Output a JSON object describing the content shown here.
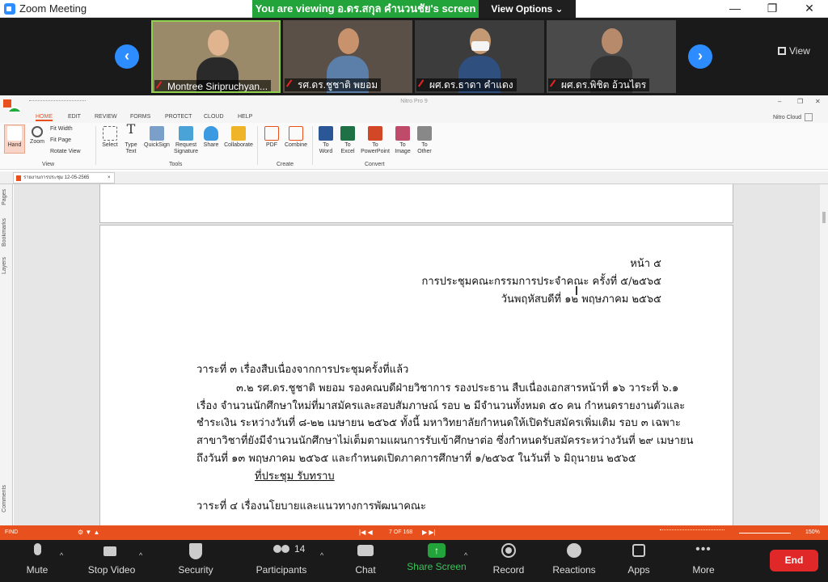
{
  "window": {
    "title": "Zoom Meeting",
    "viewing_banner": "You are viewing อ.ดร.สกุล คำนวนชัย's screen",
    "view_options": "View Options ⌄",
    "minimize": "—",
    "maximize": "❐",
    "close": "✕"
  },
  "gallery": {
    "view_label": "View",
    "prev": "‹",
    "next": "›",
    "participants": [
      {
        "name": "Montree Siripruchyan...",
        "bg": "#9a8a6a",
        "skin": "#e0b48e",
        "shirt": "#2a2a2a"
      },
      {
        "name": "รศ.ดร.ชูชาติ พยอม",
        "bg": "#5a5048",
        "skin": "#c8936c",
        "shirt": "#5b7fa8"
      },
      {
        "name": "ผศ.ดร.ธาดา คำแดง",
        "bg": "#3c3c3c",
        "skin": "#c49a74",
        "shirt": "#2f4f7f"
      },
      {
        "name": "ผศ.ดร.พิชิต อ้วนไตร",
        "bg": "#4a4a4a",
        "skin": "#b68a6a",
        "shirt": "#333"
      }
    ]
  },
  "nitro": {
    "title": "Nitro Pro 9",
    "cloud": "Nitro Cloud",
    "tabs": [
      "HOME",
      "EDIT",
      "REVIEW",
      "FORMS",
      "PROTECT",
      "CLOUD",
      "HELP"
    ],
    "ribbon": {
      "hand": "Hand",
      "zoom": "Zoom",
      "fit_width": "Fit Width",
      "fit_page": "Fit Page",
      "rotate_view": "Rotate View",
      "select": "Select",
      "type_text": "Type Text",
      "quicksign": "QuickSign",
      "request_signature": "Request Signature",
      "share": "Share",
      "collaborate": "Collaborate",
      "pdf": "PDF",
      "combine": "Combine",
      "to_word": "To Word",
      "to_excel": "To Excel",
      "to_powerpoint": "To PowerPoint",
      "to_image": "To Image",
      "to_other": "To Other",
      "group_view": "View",
      "group_tools": "Tools",
      "group_create": "Create",
      "group_convert": "Convert"
    },
    "doc_tab": "รายงานการประชุม 12-05-2565",
    "side_pages": "Pages",
    "side_bookmarks": "Bookmarks",
    "side_layers": "Layers",
    "side_comments": "Comments",
    "status_find": "FIND",
    "page_indicator": "7 OF 168",
    "zoom_level": "150%"
  },
  "document": {
    "header_page": "หน้า ๕",
    "header_meeting": "การประชุมคณะกรรมการประจำคณะ ครั้งที่ ๕/๒๕๖๕",
    "header_date": "วันพฤหัสบดีที่ ๑๒ พฤษภาคม ๒๕๖๕",
    "agenda3": "วาระที่ ๓ เรื่องสืบเนื่องจากการประชุมครั้งที่แล้ว",
    "line1": "๓.๒ รศ.ดร.ชูชาติ พยอม รองคณบดีฝ่ายวิชาการ รองประธาน สืบเนื่องเอกสารหน้าที่ ๑๖ วาระที่ ๖.๑",
    "line2": "เรื่อง จำนวนนักศึกษาใหม่ที่มาสมัครและสอบสัมภาษณ์ รอบ ๒ มีจำนวนทั้งหมด ๕๐ คน กำหนดรายงานตัวและ",
    "line3": "ชำระเงิน ระหว่างวันที่ ๘-๒๒ เมษายน ๒๕๖๕ ทั้งนี้ มหาวิทยาลัยกำหนดให้เปิดรับสมัครเพิ่มเติม รอบ ๓ เฉพาะ",
    "line4": "สาขาวิชาที่ยังมีจำนวนนักศึกษาไม่เต็มตามแผนการรับเข้าศึกษาต่อ ซึ่งกำหนดรับสมัครระหว่างวันที่ ๒๙ เมษายน",
    "line5": "ถึงวันที่ ๑๓ พฤษภาคม ๒๕๖๕ และกำหนดเปิดภาคการศึกษาที่ ๑/๒๕๖๕ ในวันที่ ๖ มิถุนายน ๒๕๖๕",
    "resolution": "ที่ประชุม รับทราบ",
    "agenda4": "วาระที่ ๔ เรื่องนโยบายและแนวทางการพัฒนาคณะ"
  },
  "controls": {
    "mute": "Mute",
    "stop_video": "Stop Video",
    "security": "Security",
    "participants": "Participants",
    "participants_count": "14",
    "chat": "Chat",
    "share_screen": "Share Screen",
    "record": "Record",
    "reactions": "Reactions",
    "apps": "Apps",
    "more": "More",
    "end": "End"
  },
  "colors": {
    "zoom_blue": "#2D8CFF",
    "share_green": "#22A43A",
    "nitro_orange": "#E8511D",
    "end_red": "#E02828"
  }
}
